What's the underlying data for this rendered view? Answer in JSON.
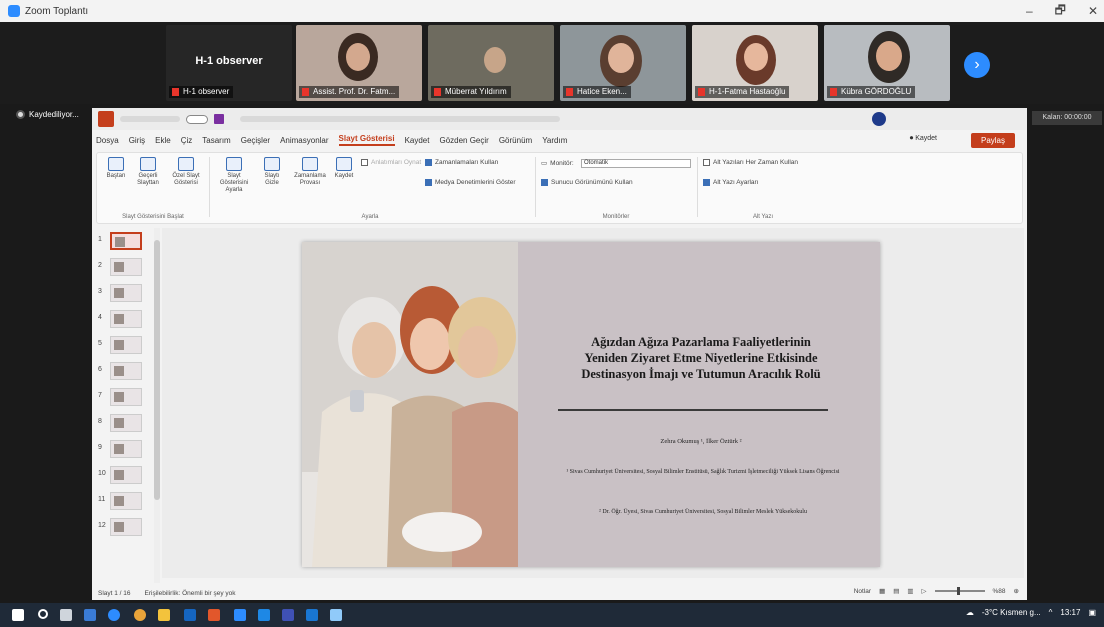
{
  "zoom": {
    "window_title": "Zoom Toplantı",
    "controls": [
      "–",
      "🗗",
      "✕"
    ]
  },
  "participants": [
    {
      "name": "H-1 observer",
      "big_label": "H-1 observer"
    },
    {
      "name": "Assist. Prof. Dr. Fatm..."
    },
    {
      "name": "Müberrat Yıldırım"
    },
    {
      "name": "Hatice Eken..."
    },
    {
      "name": "H-1-Fatma Hastaoğlu"
    },
    {
      "name": "Kübra GÖRDOĞLU"
    }
  ],
  "recording": {
    "label": "Kaydediliyor..."
  },
  "exit_label": "Kalan: 00:00:00",
  "ppt": {
    "menu": [
      "Dosya",
      "Giriş",
      "Ekle",
      "Çiz",
      "Tasarım",
      "Geçişler",
      "Animasyonlar",
      "Slayt Gösterisi",
      "Kaydet",
      "Gözden Geçir",
      "Görünüm",
      "Yardım"
    ],
    "active_menu": "Slayt Gösterisi",
    "kaydet_btn": "⏺ Kaydet",
    "share_btn": "Paylaş",
    "ribbon": {
      "b1": "Baştan",
      "b2": "Geçerli Slayttan",
      "b3": "Özel Slayt Gösterisi",
      "b4": "Slayt Gösterisini Ayarla",
      "b5": "Slaytı Gizle",
      "b6": "Zamanlama Provası",
      "b7": "Kaydet",
      "chk1": "Anlatımları Oynat",
      "chk2": "Zamanlamaları Kullan",
      "chk3": "Medya Denetimlerini Göster",
      "chk4": "Sunucu Görünümünü Kullan",
      "mon_label": "Monitör:",
      "mon_value": "Otomatik",
      "chk5": "Alt Yazıları Her Zaman Kullan",
      "chk6": "Alt Yazı Ayarları",
      "g1": "Slayt Gösterisini Başlat",
      "g2": "Ayarla",
      "g3": "Monitörler",
      "g4": "Alt Yazı"
    },
    "slide_count": 12,
    "slide": {
      "title_lines": [
        "Ağızdan Ağıza Pazarlama Faaliyetlerinin",
        "Yeniden Ziyaret Etme Niyetlerine Etkisinde",
        "Destinasyon İmajı ve Tutumun Aracılık Rolü"
      ],
      "authors": "Zehra Okumuş ¹, İlker Öztürk ²",
      "aff1": "¹ Sivas Cumhuriyet Üniversitesi, Sosyal Bilimler Enstitüsü, Sağlık Turizmi İşletmeciliği Yüksek Lisans Öğrencisi",
      "aff2": "² Dr. Öğr. Üyesi, Sivas Cumhuriyet Üniversitesi, Sosyal Bilimler Meslek Yüksekokulu"
    },
    "status": {
      "slide_pos": "Slayt 1 / 16",
      "accessibility": "Erişilebilirlik: Önemli bir şey yok",
      "notes": "Notlar",
      "zoom": "%88"
    }
  },
  "taskbar": {
    "weather": "-3°C Kısmen g...",
    "time": "13:17"
  }
}
